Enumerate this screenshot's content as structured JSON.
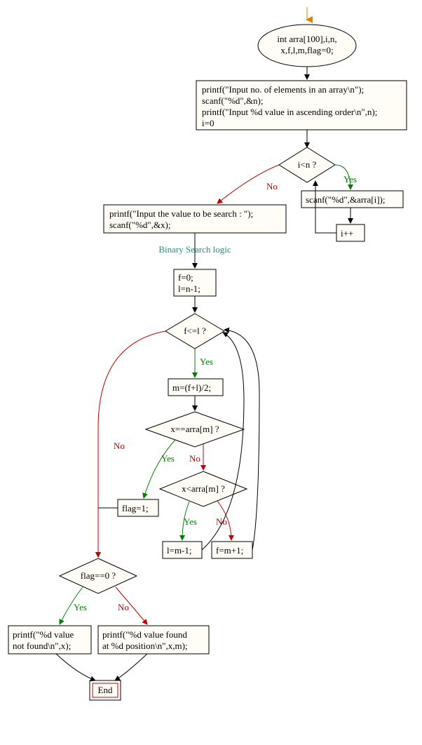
{
  "chart_data": {
    "type": "flowchart",
    "title": "Binary Search Flowchart",
    "nodes": [
      {
        "id": "start",
        "type": "start",
        "label": ""
      },
      {
        "id": "decl",
        "type": "process",
        "label": "int arra[100],i,n,\nx,f,l,m,flag=0;"
      },
      {
        "id": "input1",
        "type": "process",
        "label": "printf(\"Input no. of elements in  an array\\n\");\nscanf(\"%d\",&n);\nprintf(\"Input  %d value in ascending order\\n\",n);\ni=0"
      },
      {
        "id": "loopcond",
        "type": "decision",
        "label": "i<n ?"
      },
      {
        "id": "scanarr",
        "type": "process",
        "label": "scanf(\"%d\",&arra[i]);"
      },
      {
        "id": "incr",
        "type": "process",
        "label": "i++"
      },
      {
        "id": "inputx",
        "type": "process",
        "label": "printf(\"Input  the value to be search : \");\nscanf(\"%d\",&x);"
      },
      {
        "id": "comment",
        "type": "comment",
        "label": "Binary Search  logic"
      },
      {
        "id": "init",
        "type": "process",
        "label": "f=0;\nl=n-1;"
      },
      {
        "id": "whilecond",
        "type": "decision",
        "label": "f<=l ?"
      },
      {
        "id": "mid",
        "type": "process",
        "label": "m=(f+l)/2;"
      },
      {
        "id": "eqcond",
        "type": "decision",
        "label": "x==arra[m] ?"
      },
      {
        "id": "flag1",
        "type": "process",
        "label": "flag=1;"
      },
      {
        "id": "ltcond",
        "type": "decision",
        "label": "x<arra[m] ?"
      },
      {
        "id": "setl",
        "type": "process",
        "label": "l=m-1;"
      },
      {
        "id": "setf",
        "type": "process",
        "label": "f=m+1;"
      },
      {
        "id": "flagcond",
        "type": "decision",
        "label": "flag==0 ?"
      },
      {
        "id": "notfound",
        "type": "process",
        "label": "printf(\"%d  value\nnot found\\n\",x);"
      },
      {
        "id": "found",
        "type": "process",
        "label": "printf(\"%d value  found\nat %d position\\n\",x,m);"
      },
      {
        "id": "end",
        "type": "end",
        "label": "End"
      }
    ],
    "edges": [
      {
        "from": "start",
        "to": "decl"
      },
      {
        "from": "decl",
        "to": "input1"
      },
      {
        "from": "input1",
        "to": "loopcond"
      },
      {
        "from": "loopcond",
        "to": "scanarr",
        "label": "Yes"
      },
      {
        "from": "scanarr",
        "to": "incr"
      },
      {
        "from": "incr",
        "to": "loopcond"
      },
      {
        "from": "loopcond",
        "to": "inputx",
        "label": "No"
      },
      {
        "from": "inputx",
        "to": "init"
      },
      {
        "from": "init",
        "to": "whilecond"
      },
      {
        "from": "whilecond",
        "to": "mid",
        "label": "Yes"
      },
      {
        "from": "mid",
        "to": "eqcond"
      },
      {
        "from": "eqcond",
        "to": "flag1",
        "label": "Yes"
      },
      {
        "from": "eqcond",
        "to": "ltcond",
        "label": "No"
      },
      {
        "from": "ltcond",
        "to": "setl",
        "label": "Yes"
      },
      {
        "from": "ltcond",
        "to": "setf",
        "label": "No"
      },
      {
        "from": "setl",
        "to": "whilecond"
      },
      {
        "from": "setf",
        "to": "whilecond"
      },
      {
        "from": "flag1",
        "to": "flagcond"
      },
      {
        "from": "whilecond",
        "to": "flagcond",
        "label": "No"
      },
      {
        "from": "flagcond",
        "to": "notfound",
        "label": "Yes"
      },
      {
        "from": "flagcond",
        "to": "found",
        "label": "No"
      },
      {
        "from": "notfound",
        "to": "end"
      },
      {
        "from": "found",
        "to": "end"
      }
    ]
  },
  "labels": {
    "yes": "Yes",
    "no": "No",
    "comment": "Binary Search  logic",
    "end": "End"
  },
  "nodes": {
    "decl_l1": "int arra[100],i,n,",
    "decl_l2": "x,f,l,m,flag=0;",
    "input1_l1": "printf(\"Input no. of elements in  an array\\n\");",
    "input1_l2": "scanf(\"%d\",&n);",
    "input1_l3": "printf(\"Input  %d value in ascending order\\n\",n);",
    "input1_l4": "i=0",
    "loopcond": "i<n ?",
    "scanarr": "scanf(\"%d\",&arra[i]);",
    "incr": "i++",
    "inputx_l1": "printf(\"Input  the value to be search : \");",
    "inputx_l2": "scanf(\"%d\",&x);",
    "init_l1": "f=0;",
    "init_l2": "l=n-1;",
    "whilecond": "f<=l ?",
    "mid": "m=(f+l)/2;",
    "eqcond": "x==arra[m] ?",
    "flag1": "flag=1;",
    "ltcond": "x<arra[m] ?",
    "setl": "l=m-1;",
    "setf": "f=m+1;",
    "flagcond": "flag==0 ?",
    "notfound_l1": "printf(\"%d  value",
    "notfound_l2": "not found\\n\",x);",
    "found_l1": "printf(\"%d value  found",
    "found_l2": "at %d position\\n\",x,m);"
  }
}
